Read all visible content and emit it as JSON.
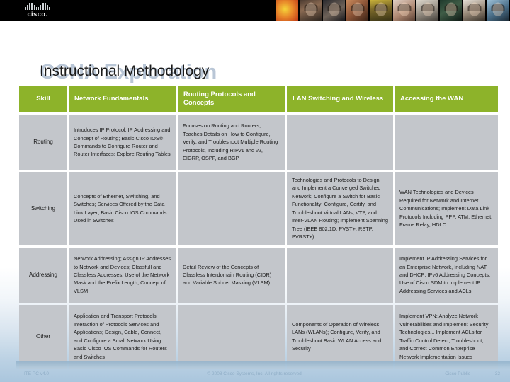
{
  "topbar": {
    "logo_name": "cisco-logo",
    "logo_wordmark": "cisco.",
    "photo_strip_label": "people-photo-strip",
    "photos": [
      "photo-abstract-orange",
      "photo-student-1",
      "photo-student-2",
      "photo-student-3",
      "photo-student-4",
      "photo-student-5",
      "photo-student-6",
      "photo-student-7",
      "photo-student-8",
      "photo-student-9",
      "photo-student-10"
    ]
  },
  "title": {
    "background_text": "CCNA Exploration",
    "foreground_text": "Instructional Methodology"
  },
  "table": {
    "columns": [
      "Skill",
      "Network Fundamentals",
      "Routing Protocols and Concepts",
      "LAN Switching and Wireless",
      "Accessing the WAN"
    ],
    "rows": [
      {
        "skill": "Routing",
        "network_fundamentals": "Introduces IP Protocol, IP Addressing and Concept of Routing; Basic Cisco IOS® Commands to Configure Router and Router Interfaces; Explore Routing Tables",
        "routing_protocols": "Focuses on Routing and Routers; Teaches Details on How to Configure, Verify, and Troubleshoot Multiple Routing Protocols, Including RIPv1 and v2, EIGRP, OSPF, and BGP",
        "lan_switching": "",
        "accessing_wan": ""
      },
      {
        "skill": "Switching",
        "network_fundamentals": "Concepts of Ethernet, Switching, and Switches; Services Offered by the Data Link Layer; Basic Cisco IOS Commands Used in Switches",
        "routing_protocols": "",
        "lan_switching": "Technologies and Protocols to Design and Implement a Converged Switched Network; Configure a Switch for Basic Functionality; Configure, Certify, and Troubleshoot Virtual LANs, VTP, and Inter-VLAN Routing; Implement Spanning Tree (IEEE 802.1D, PVST+, RSTP, PVRST+)",
        "accessing_wan": "WAN Technologies and Devices Required for Network and Internet Communications; Implement Data Link Protocols Including PPP, ATM, Ethernet, Frame Relay, HDLC"
      },
      {
        "skill": "Addressing",
        "network_fundamentals": "Network Addressing; Assign IP Addresses to Network and Devices; Classfull and Classless Addresses; Use of the Network Mask and the Prefix Length; Concept of VLSM",
        "routing_protocols": "Detail Review of the Concepts of Classless Interdomain Routing (CIDR) and Variable Subnet Masking (VLSM)",
        "lan_switching": "",
        "accessing_wan": "Implement IP Addressing Services for an Enterprise Network, Including NAT and DHCP; IPv6 Addressing Concepts; Use of Cisco SDM to Implement IP Addressing Services and ACLs"
      },
      {
        "skill": "Other",
        "network_fundamentals": "Application and Transport Protocols; Interaction of Protocols Services and Applications; Design, Cable, Connect, and Configure a Small Network Using Basic Cisco IOS Commands for Routers and Switches",
        "routing_protocols": "",
        "lan_switching": "Components of Operation of Wireless LANs (WLANs); Configure, Verify, and Troubleshoot Basic WLAN Access and Security",
        "accessing_wan": "Implement VPN; Analyze Network Vulnerabilities and Implement Security Technologies... Implement ACLs for Traffic Control Detect, Troubleshoot, and Correct Common Enterprise Network Implementation Issues"
      }
    ]
  },
  "footer": {
    "left": "ITE PC v4.0",
    "center": "© 2008 Cisco Systems, Inc. All rights reserved.",
    "right": "Cisco Public",
    "page": "32"
  },
  "colors": {
    "header_green": "#8db32a",
    "cell_gray": "#c3c6cb",
    "title_back": "#b9c6d6",
    "title_front": "#1b1b1b"
  }
}
